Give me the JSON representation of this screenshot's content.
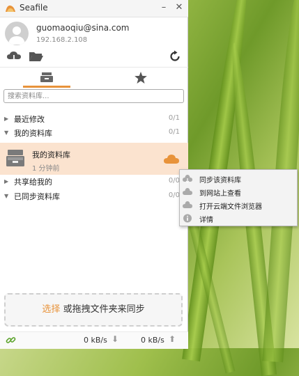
{
  "window": {
    "app_title": "Seafile",
    "minimize_symbol": "–",
    "close_symbol": "✕"
  },
  "account": {
    "email": "guomaoqiu@sina.com",
    "server": "192.168.2.108"
  },
  "toolbar": {
    "icons": [
      "cloud-upload-icon",
      "folder-open-icon",
      "refresh-icon"
    ]
  },
  "tabs": [
    {
      "icon": "repos-drawer-icon",
      "active": true
    },
    {
      "icon": "star-icon",
      "active": false
    }
  ],
  "search": {
    "placeholder": "搜索资料库..."
  },
  "categories": {
    "recent": {
      "label": "最近修改",
      "count": "0/1",
      "expanded": false
    },
    "mine": {
      "label": "我的资料库",
      "count": "0/1",
      "expanded": true
    },
    "shared": {
      "label": "共享给我的",
      "count": "0/0",
      "expanded": false
    },
    "synced": {
      "label": "已同步资料库",
      "count": "0/0",
      "expanded": true
    }
  },
  "repo": {
    "name": "我的资料库",
    "time": "1 分钟前",
    "status_color": "#e8933a"
  },
  "drop_zone": {
    "link": "选择",
    "text": " 或拖拽文件夹来同步"
  },
  "footer": {
    "download_rate": "0 kB/s",
    "upload_rate": "0 kB/s",
    "download_arrow": "⬇",
    "upload_arrow": "⬆"
  },
  "context_menu": {
    "items": [
      {
        "label": "同步该资料库",
        "icon": "cloud-sync-icon"
      },
      {
        "label": "到网站上查看",
        "icon": "cloud-icon"
      },
      {
        "label": "打开云端文件浏览器",
        "icon": "cloud-icon"
      },
      {
        "label": "详情",
        "icon": "info-icon"
      }
    ]
  },
  "colors": {
    "accent": "#e8933a",
    "selected_row": "#fbe3cf"
  }
}
